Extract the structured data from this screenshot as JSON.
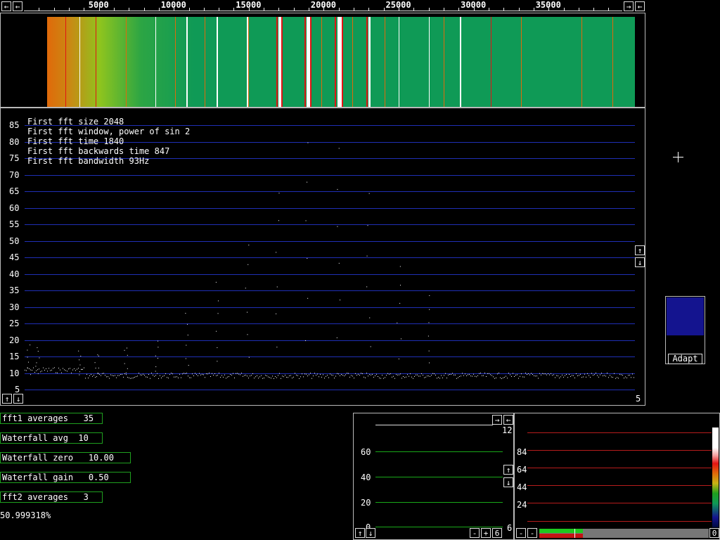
{
  "freq_axis": {
    "ticks": [
      "5000",
      "10000",
      "15000",
      "20000",
      "25000",
      "30000",
      "35000"
    ]
  },
  "waterfall": {
    "colors": {
      "base": "#0f9a56",
      "low": "#e06a0a",
      "mid": "#8ec41e",
      "line": "#ffffff",
      "hot": "#e21414"
    }
  },
  "spectrum": {
    "info_lines": [
      "First fft size 2048",
      "First fft window, power of sin 2",
      "First fft time 1840",
      "First fft backwards time 847",
      "First fft bandwidth 93Hz"
    ],
    "y_labels": [
      "85",
      "80",
      "75",
      "70",
      "65",
      "60",
      "55",
      "50",
      "45",
      "40",
      "35",
      "30",
      "25",
      "20",
      "15",
      "10",
      "5"
    ],
    "corner_value": "5",
    "colors": {
      "grid": "#1f2fb5",
      "trace": "#ffffff"
    }
  },
  "controls": {
    "fft1_averages": "fft1 averages   35",
    "waterfall_avg": "Waterfall avg  10",
    "waterfall_zero": "Waterfall zero   10.00",
    "waterfall_gain": "Waterfall gain   0.50",
    "fft2_averages": "fft2 averages   3",
    "status": "50.999318%"
  },
  "adapt": {
    "label": "Adapt",
    "color": "#14148f"
  },
  "graph2": {
    "top_label": "12",
    "y_labels": [
      "60",
      "40",
      "20",
      "0"
    ],
    "bottom_value": "6"
  },
  "graph3": {
    "y_labels": [
      "84",
      "64",
      "44",
      "24"
    ],
    "bottom_value": "0"
  },
  "icons": {
    "left": "←",
    "right": "→",
    "up": "↑",
    "down": "↓",
    "plus": "+",
    "minus": "-"
  }
}
